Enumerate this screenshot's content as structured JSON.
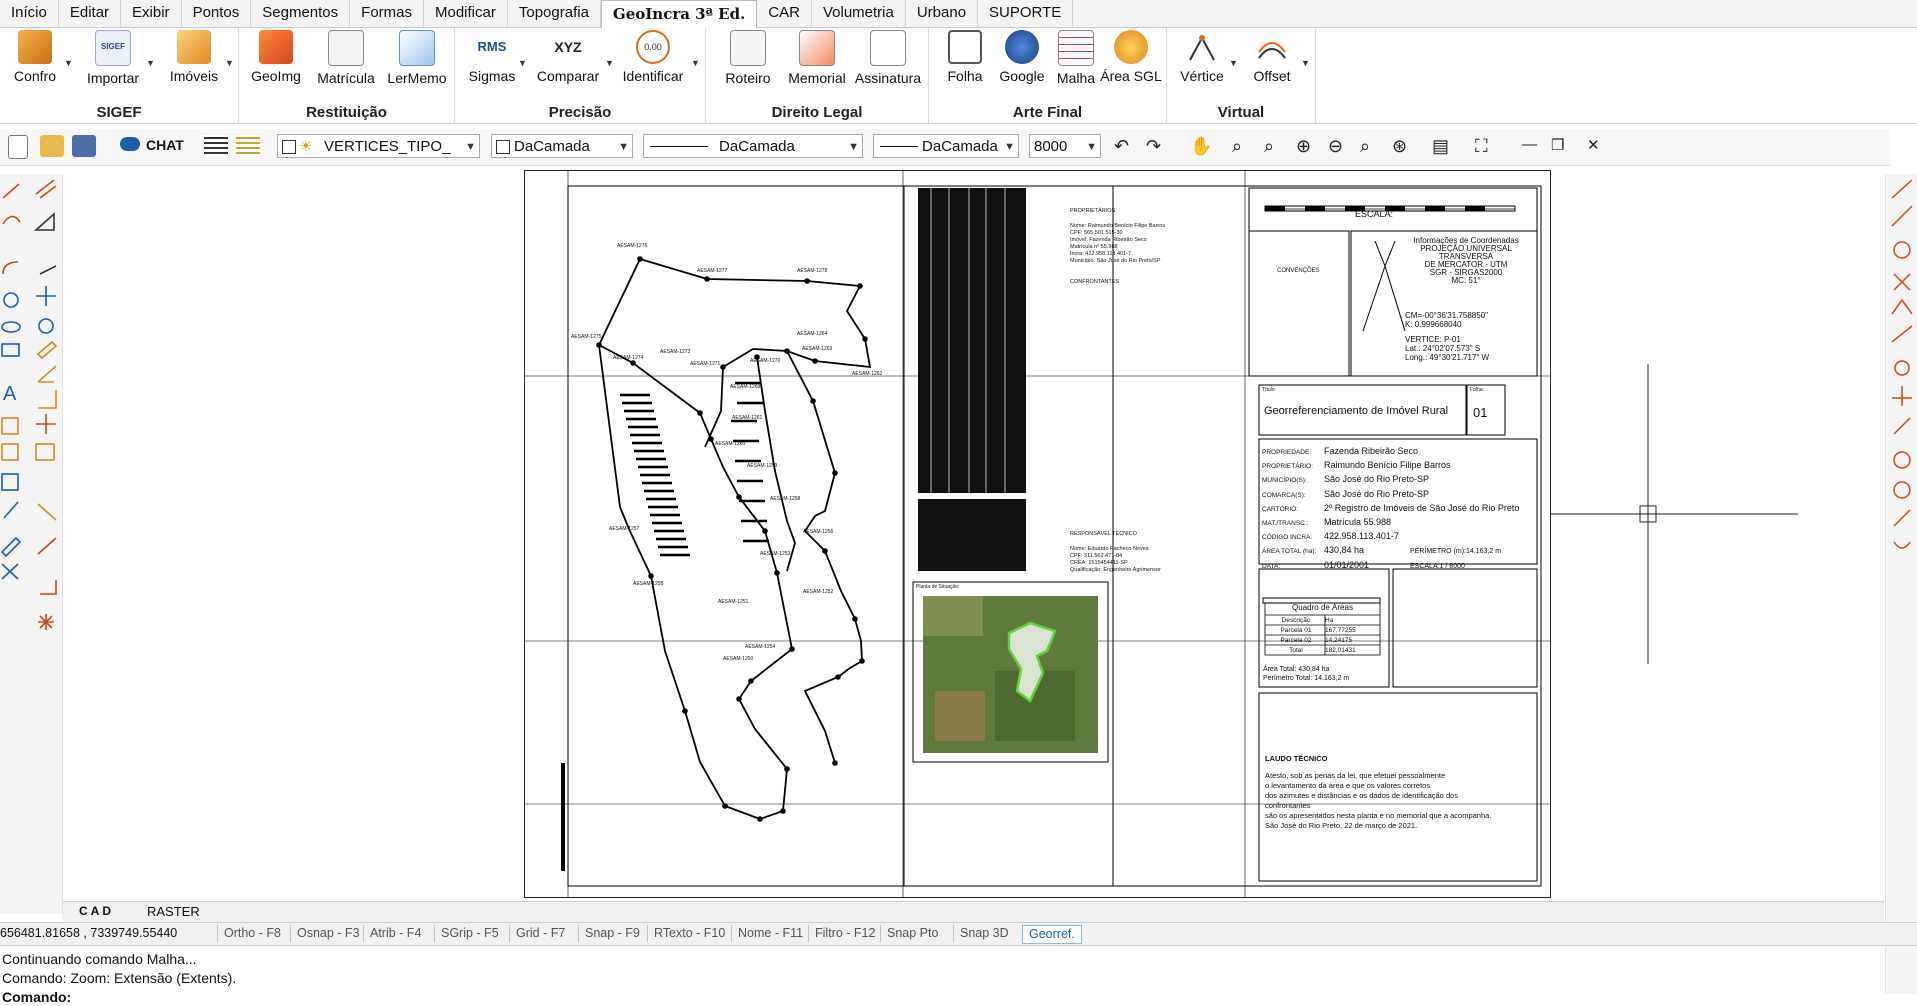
{
  "tabs": [
    "Início",
    "Editar",
    "Exibir",
    "Pontos",
    "Segmentos",
    "Formas",
    "Modificar",
    "Topografia",
    "GeoIncra 3ª Ed.",
    "CAR",
    "Volumetria",
    "Urbano",
    "SUPORTE"
  ],
  "active_tab": "GeoIncra 3ª Ed.",
  "ribbon": {
    "groups": [
      {
        "title": "SIGEF",
        "buttons": [
          "Confro",
          "Importar",
          "Imóveis"
        ]
      },
      {
        "title": "Restituição",
        "buttons": [
          "GeoImg",
          "Matrícula",
          "LerMemo"
        ]
      },
      {
        "title": "Precisão",
        "buttons": [
          "Sigmas",
          "Comparar",
          "Identificar"
        ]
      },
      {
        "title": "Direito Legal",
        "buttons": [
          "Roteiro",
          "Memorial",
          "Assinatura"
        ]
      },
      {
        "title": "Arte Final",
        "buttons": [
          "Folha",
          "Google",
          "Malha",
          "Área SGL"
        ]
      },
      {
        "title": "Virtual",
        "buttons": [
          "Vértice",
          "Offset"
        ]
      }
    ],
    "icon_badges": {
      "sigef": "SIGEF",
      "rms": "RMS",
      "xyz": "XYZ",
      "identify": "0.00"
    }
  },
  "toolbar": {
    "chat_label": "CHAT",
    "layer_combo": "VERTICES_TIPO_",
    "color_combo": "DaCamada",
    "linetype_combo": "DaCamada",
    "lineweight_combo": "DaCamada",
    "scale_combo": "8000"
  },
  "drawing": {
    "escala_title": "ESCALA:",
    "convencoes_title": "CONVENÇÕES",
    "coord_title": "Informações de Coordenadas",
    "coord_lines": [
      "PROJEÇÃO UNIVERSAL TRANSVERSA",
      "DE MERCATOR - UTM",
      "SGR - SIRGAS2000",
      "MC: 51°"
    ],
    "cm_line": "CM=-00°36'31.758850\"",
    "k_line": "K: 0.999668040",
    "vertice_line": "VERTICE: P-01",
    "lat_line": "Lat.: 24°02'07.573\" S",
    "long_line": "Long.: 49°30'21.717\" W",
    "titulo_label": "Título:",
    "titulo": "Georreferenciamento de Imóvel Rural",
    "folha_label": "Folha:",
    "folha": "01",
    "fields": [
      {
        "label": "PROPRIEDADE:",
        "value": "Fazenda Ribeirão Seco"
      },
      {
        "label": "PROPRIETÁRIO:",
        "value": "Raimundo Benício Filipe Barros"
      },
      {
        "label": "MUNICÍPIO(S):",
        "value": "São José do Rio Preto-SP"
      },
      {
        "label": "COMARCA(S):",
        "value": "São José do Rio Preto-SP"
      },
      {
        "label": "CARTÓRIO:",
        "value": "2º Registro de Imóveis de São José do Rio Preto"
      },
      {
        "label": "MAT./TRANSC.:",
        "value": "Matrícula 55.988"
      },
      {
        "label": "CÓDIGO INCRA:",
        "value": "422.958.113.401-7"
      },
      {
        "label": "ÁREA TOTAL (ha):",
        "value": "430,84 ha"
      },
      {
        "label": "DATA:",
        "value": "01/01/2001"
      }
    ],
    "perimetro": "PERÍMETRO (m):14.163,2 m",
    "escala_sheet": "ESCALA:1 / 8000",
    "quadro_title": "Quadro de Áreas",
    "quadro_headers": [
      "Descrição",
      "Ha"
    ],
    "quadro_rows": [
      [
        "Parcela 01",
        "167,77255"
      ],
      [
        "Parcela 02",
        "14,24175"
      ],
      [
        "Total",
        "182,01431"
      ]
    ],
    "area_total_line": "Área Total: 430,84 ha",
    "perimetro_total_line": "Perímetro Total: 14.163,2 m",
    "laudo_title": "LAUDO TÉCNICO",
    "laudo_lines": [
      "Atesto, sob as penas da lei, que efetuei pessoalmente",
      "o levantamento da área e que os valores corretos",
      "dos azimutes e distâncias e os dados de identificação dos",
      "confrontantes",
      "são os apresentados nesta planta e no memorial que a acompanha.",
      "São José do Rio Preto, 22 de março de 2021."
    ],
    "situacao_title": "Planta de Situação:",
    "memo_title": "PROPRIETÁRIOS",
    "memo_lines": [
      "Nome: Raimundo Benício Filipe Barros",
      "CPF: 565.501.515-30",
      "Imóvel: Fazenda Ribeirão Seco",
      "Matrícula nº 55.988",
      "Incra: 422.958.113.401-7",
      "Município: São José do Rio Preto/SP"
    ],
    "confrontantes_title": "CONFRONTANTES",
    "resp_title": "RESPONSÁVEL TÉCNICO",
    "resp_lines": [
      "Nome: Eduardo Pacheco Neves",
      "CPF: 311.562.471-04",
      "CREA: 1515454411-SP",
      "Qualificação: Engenheiro Agrimensor"
    ],
    "vertex_labels": [
      "AESAM-1276",
      "AESAM-1277",
      "AESAM-1278",
      "AESAM-1275",
      "AESAM-1274",
      "AESAM-1273",
      "AESAM-1271",
      "AESAM-1270",
      "AESAM-1269",
      "AESAM-1264",
      "AESAM-1263",
      "AESAM-1262",
      "AESAM-1261",
      "AESAM-1260",
      "AESAM-1259",
      "AESAM-1258",
      "AESAM-1257",
      "AESAM-1256",
      "AESAM-1255",
      "AESAM-1254",
      "AESAM-1253",
      "AESAM-1252",
      "AESAM-1251",
      "AESAM-1250"
    ]
  },
  "bottom_tabs": [
    "CAD",
    "RASTER"
  ],
  "status": {
    "coords": "656481.81658 , 7339749.55440",
    "buttons": [
      "Ortho - F8",
      "Osnap - F3",
      "Atrib - F4",
      "SGrip - F5",
      "Grid - F7",
      "Snap - F9",
      "RTexto - F10",
      "Nome - F11",
      "Filtro - F12",
      "Snap Pto",
      "Snap 3D",
      "Georref."
    ],
    "active": "Georref."
  },
  "command_lines": [
    "Continuando comando Malha...",
    "Comando: Zoom: Extensão (Extents).",
    "Comando:"
  ]
}
